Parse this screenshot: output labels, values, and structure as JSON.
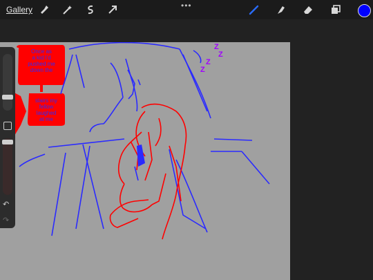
{
  "app": {
    "gallery_label": "Gallery",
    "more_menu": "•••"
  },
  "toolbar": {
    "left_tools": [
      "wrench-icon",
      "magic-wand-icon",
      "selection-icon",
      "transform-arrow-icon"
    ],
    "right_tools": [
      "brush-icon",
      "smudge-icon",
      "eraser-icon",
      "layers-icon"
    ],
    "active_color": "#0000ff"
  },
  "sidebar": {
    "undo_label": "↶",
    "redo_label": "↷"
  },
  "artwork": {
    "bubble_top_lines": [
      "Once as",
      "a kid I'd",
      "pushed me",
      "down the"
    ],
    "bubble_bottom_lines": [
      "stairs my",
      "fellow",
      "laughed",
      "at me"
    ],
    "sleep_marks": [
      "Z",
      "Z",
      "Z",
      "Z"
    ],
    "colors": {
      "sketch_blue": "#2a2aff",
      "sketch_red": "#ff0000",
      "sleep_purple": "#a000ff",
      "canvas_gray": "#a0a0a0"
    }
  }
}
